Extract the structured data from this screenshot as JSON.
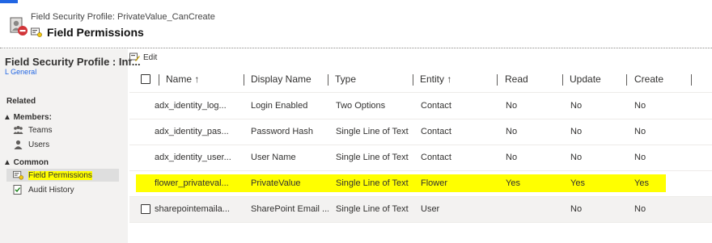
{
  "header": {
    "entity_type_label": "Field Security Profile: PrivateValue_CanCreate",
    "title": "Field Permissions"
  },
  "left_nav": {
    "title": "Field Security Profile : Inf...",
    "subtitle": "L General",
    "related_label": "Related",
    "members_label": "▲ Members:",
    "teams_label": "Teams",
    "users_label": "Users",
    "common_label": "▲ Common",
    "field_permissions_label": "Field Permissions",
    "audit_history_label": "Audit History"
  },
  "toolbar": {
    "edit_label": "Edit"
  },
  "grid": {
    "columns": {
      "name": "Name ↑",
      "display_name": "Display Name",
      "type": "Type",
      "entity": "Entity ↑",
      "read": "Read",
      "update": "Update",
      "create": "Create"
    },
    "rows": [
      {
        "name": "adx_identity_log...",
        "display_name": "Login Enabled",
        "type": "Two Options",
        "entity": "Contact",
        "read": "No",
        "update": "No",
        "create": "No"
      },
      {
        "name": "adx_identity_pas...",
        "display_name": "Password Hash",
        "type": "Single Line of Text",
        "entity": "Contact",
        "read": "No",
        "update": "No",
        "create": "No"
      },
      {
        "name": "adx_identity_user...",
        "display_name": "User Name",
        "type": "Single Line of Text",
        "entity": "Contact",
        "read": "No",
        "update": "No",
        "create": "No"
      },
      {
        "name": "flower_privateval...",
        "display_name": "PrivateValue",
        "type": "Single Line of Text",
        "entity": "Flower",
        "read": "Yes",
        "update": "Yes",
        "create": "Yes"
      },
      {
        "name": "sharepointemaila...",
        "display_name": "SharePoint Email ...",
        "type": "Single Line of Text",
        "entity": "User",
        "read": "",
        "update": "No",
        "create": "No"
      }
    ]
  },
  "colors": {
    "accent": "#2266e3",
    "highlight": "#ffff00",
    "nav_bg": "#f3f2f1"
  }
}
